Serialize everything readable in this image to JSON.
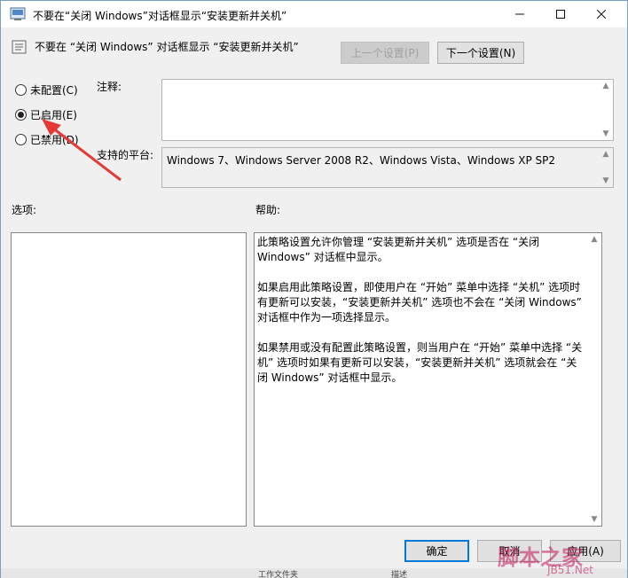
{
  "window": {
    "title": "不要在“关闭 Windows”对话框显示“安装更新并关机”"
  },
  "header": {
    "policy_title": "不要在 “关闭 Windows” 对话框显示 “安装更新并关机”",
    "prev_button": "上一个设置(P)",
    "next_button": "下一个设置(N)"
  },
  "state": {
    "options": [
      {
        "label": "未配置(C)",
        "selected": false
      },
      {
        "label": "已启用(E)",
        "selected": true
      },
      {
        "label": "已禁用(D)",
        "selected": false
      }
    ]
  },
  "comment": {
    "label": "注释:",
    "value": ""
  },
  "supported": {
    "label": "支持的平台:",
    "value": "Windows 7、Windows Server 2008 R2、Windows Vista、Windows XP SP2"
  },
  "options_label": "选项:",
  "help": {
    "label": "帮助:",
    "paragraphs": [
      "此策略设置允许你管理 “安装更新并关机” 选项是否在 “关闭 Windows” 对话框中显示。",
      "如果启用此策略设置，即使用户在 “开始” 菜单中选择 “关机” 选项时有更新可以安装，“安装更新并关机” 选项也不会在 “关闭 Windows” 对话框中作为一项选择显示。",
      "如果禁用或没有配置此策略设置，则当用户在 “开始” 菜单中选择 “关机” 选项时如果有更新可以安装，“安装更新并关机” 选项就会在 “关闭 Windows” 对话框中显示。"
    ]
  },
  "footer": {
    "ok_button": "确定",
    "cancel_button": "取消",
    "apply_button": "应用(A)"
  },
  "watermark": {
    "text": "脚本之家",
    "site": "JB51.Net"
  },
  "background": {
    "item1": "工作文件夹",
    "item2": "描述"
  },
  "colors": {
    "accent": "#0078d7",
    "annotation_arrow": "#e53935"
  }
}
